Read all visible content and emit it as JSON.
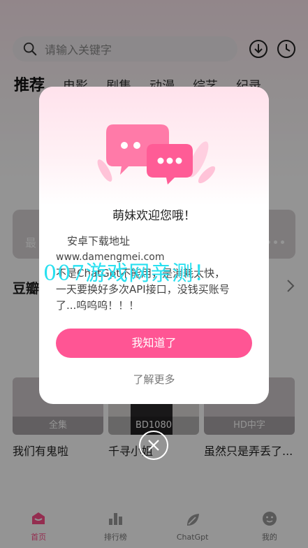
{
  "search": {
    "placeholder": "请输入关键字"
  },
  "top_icons": [
    "download-icon",
    "history-icon"
  ],
  "tabs": [
    {
      "label": "推荐",
      "active": true
    },
    {
      "label": "电影"
    },
    {
      "label": "剧集"
    },
    {
      "label": "动漫"
    },
    {
      "label": "综艺"
    },
    {
      "label": "纪录"
    }
  ],
  "banner": {
    "text": "最"
  },
  "section": {
    "title": "豆瓣"
  },
  "cards": [
    {
      "badge": "全集",
      "title": "我们有鬼啦"
    },
    {
      "badge": "BD1080",
      "title": "千寻小姐"
    },
    {
      "badge": "HD中字",
      "title": "虽然只是弄丢了..."
    }
  ],
  "modal": {
    "title": "萌妹欢迎您哦！",
    "line1": "安卓下载地址",
    "line2": "www.damengmei.com",
    "line3": "不是ChatGpt不能用，是消耗太快，",
    "line4": "一天要换好多次API接口，没钱买账号",
    "line5": "了...呜呜呜！！！",
    "ok_label": "我知道了",
    "more_label": "了解更多"
  },
  "watermark": "007游戏网亲测！",
  "bottom_nav": [
    {
      "label": "首页",
      "icon": "home-icon",
      "active": true
    },
    {
      "label": "排行榜",
      "icon": "ranking-icon"
    },
    {
      "label": "ChatGpt",
      "icon": "chat-leaf-icon"
    },
    {
      "label": "我的",
      "icon": "profile-icon"
    }
  ],
  "colors": {
    "accent": "#ff5594",
    "watermark": "#28e0f0",
    "overlay": "rgba(0,0,0,0.42)"
  }
}
